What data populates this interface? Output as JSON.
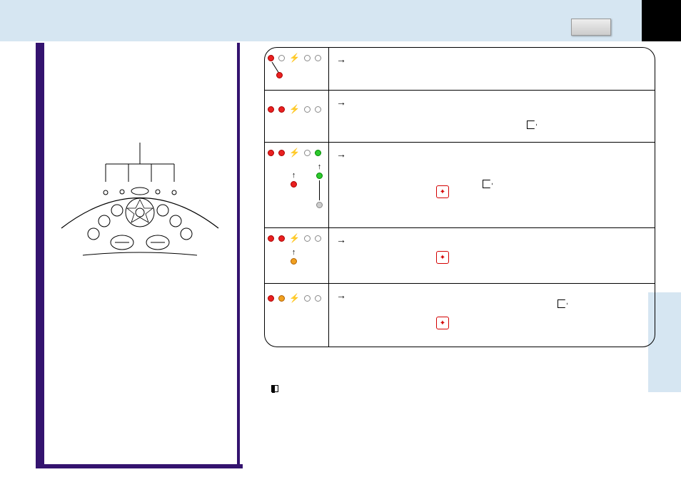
{
  "page": {
    "top_bar_color": "#d6e6f2",
    "side_tab_color": "#d6e6f2"
  },
  "camera_diagram": {
    "label": "indicator-lamps",
    "callout_count": 4
  },
  "table": {
    "rows": [
      {
        "id": "row1",
        "lamps": [
          "red",
          "off",
          "bolt",
          "off",
          "off"
        ],
        "extra_lamp_below": "red",
        "arrow": "→",
        "desc": ""
      },
      {
        "id": "row2",
        "lamps": [
          "red",
          "red",
          "bolt",
          "off",
          "off"
        ],
        "arrow": "→",
        "desc": "",
        "pentagon": true
      },
      {
        "id": "row3",
        "lamps": [
          "red",
          "red",
          "bolt",
          "off",
          "green"
        ],
        "column_transition": [
          "gray",
          "green"
        ],
        "arrow": "→",
        "desc": "",
        "card_icon": true,
        "pentagon": true
      },
      {
        "id": "row4",
        "lamps": [
          "red",
          "red",
          "bolt",
          "off",
          "off"
        ],
        "column_transition": [
          "orange"
        ],
        "arrow": "→",
        "desc": "",
        "card_icon": true
      },
      {
        "id": "row5",
        "lamps": [
          "red",
          "orange",
          "bolt",
          "off",
          "off"
        ],
        "arrow": "→",
        "desc": "",
        "card_icon": true,
        "pentagon": true
      }
    ]
  },
  "footnote": {
    "marker": "note-marker",
    "text": ""
  }
}
